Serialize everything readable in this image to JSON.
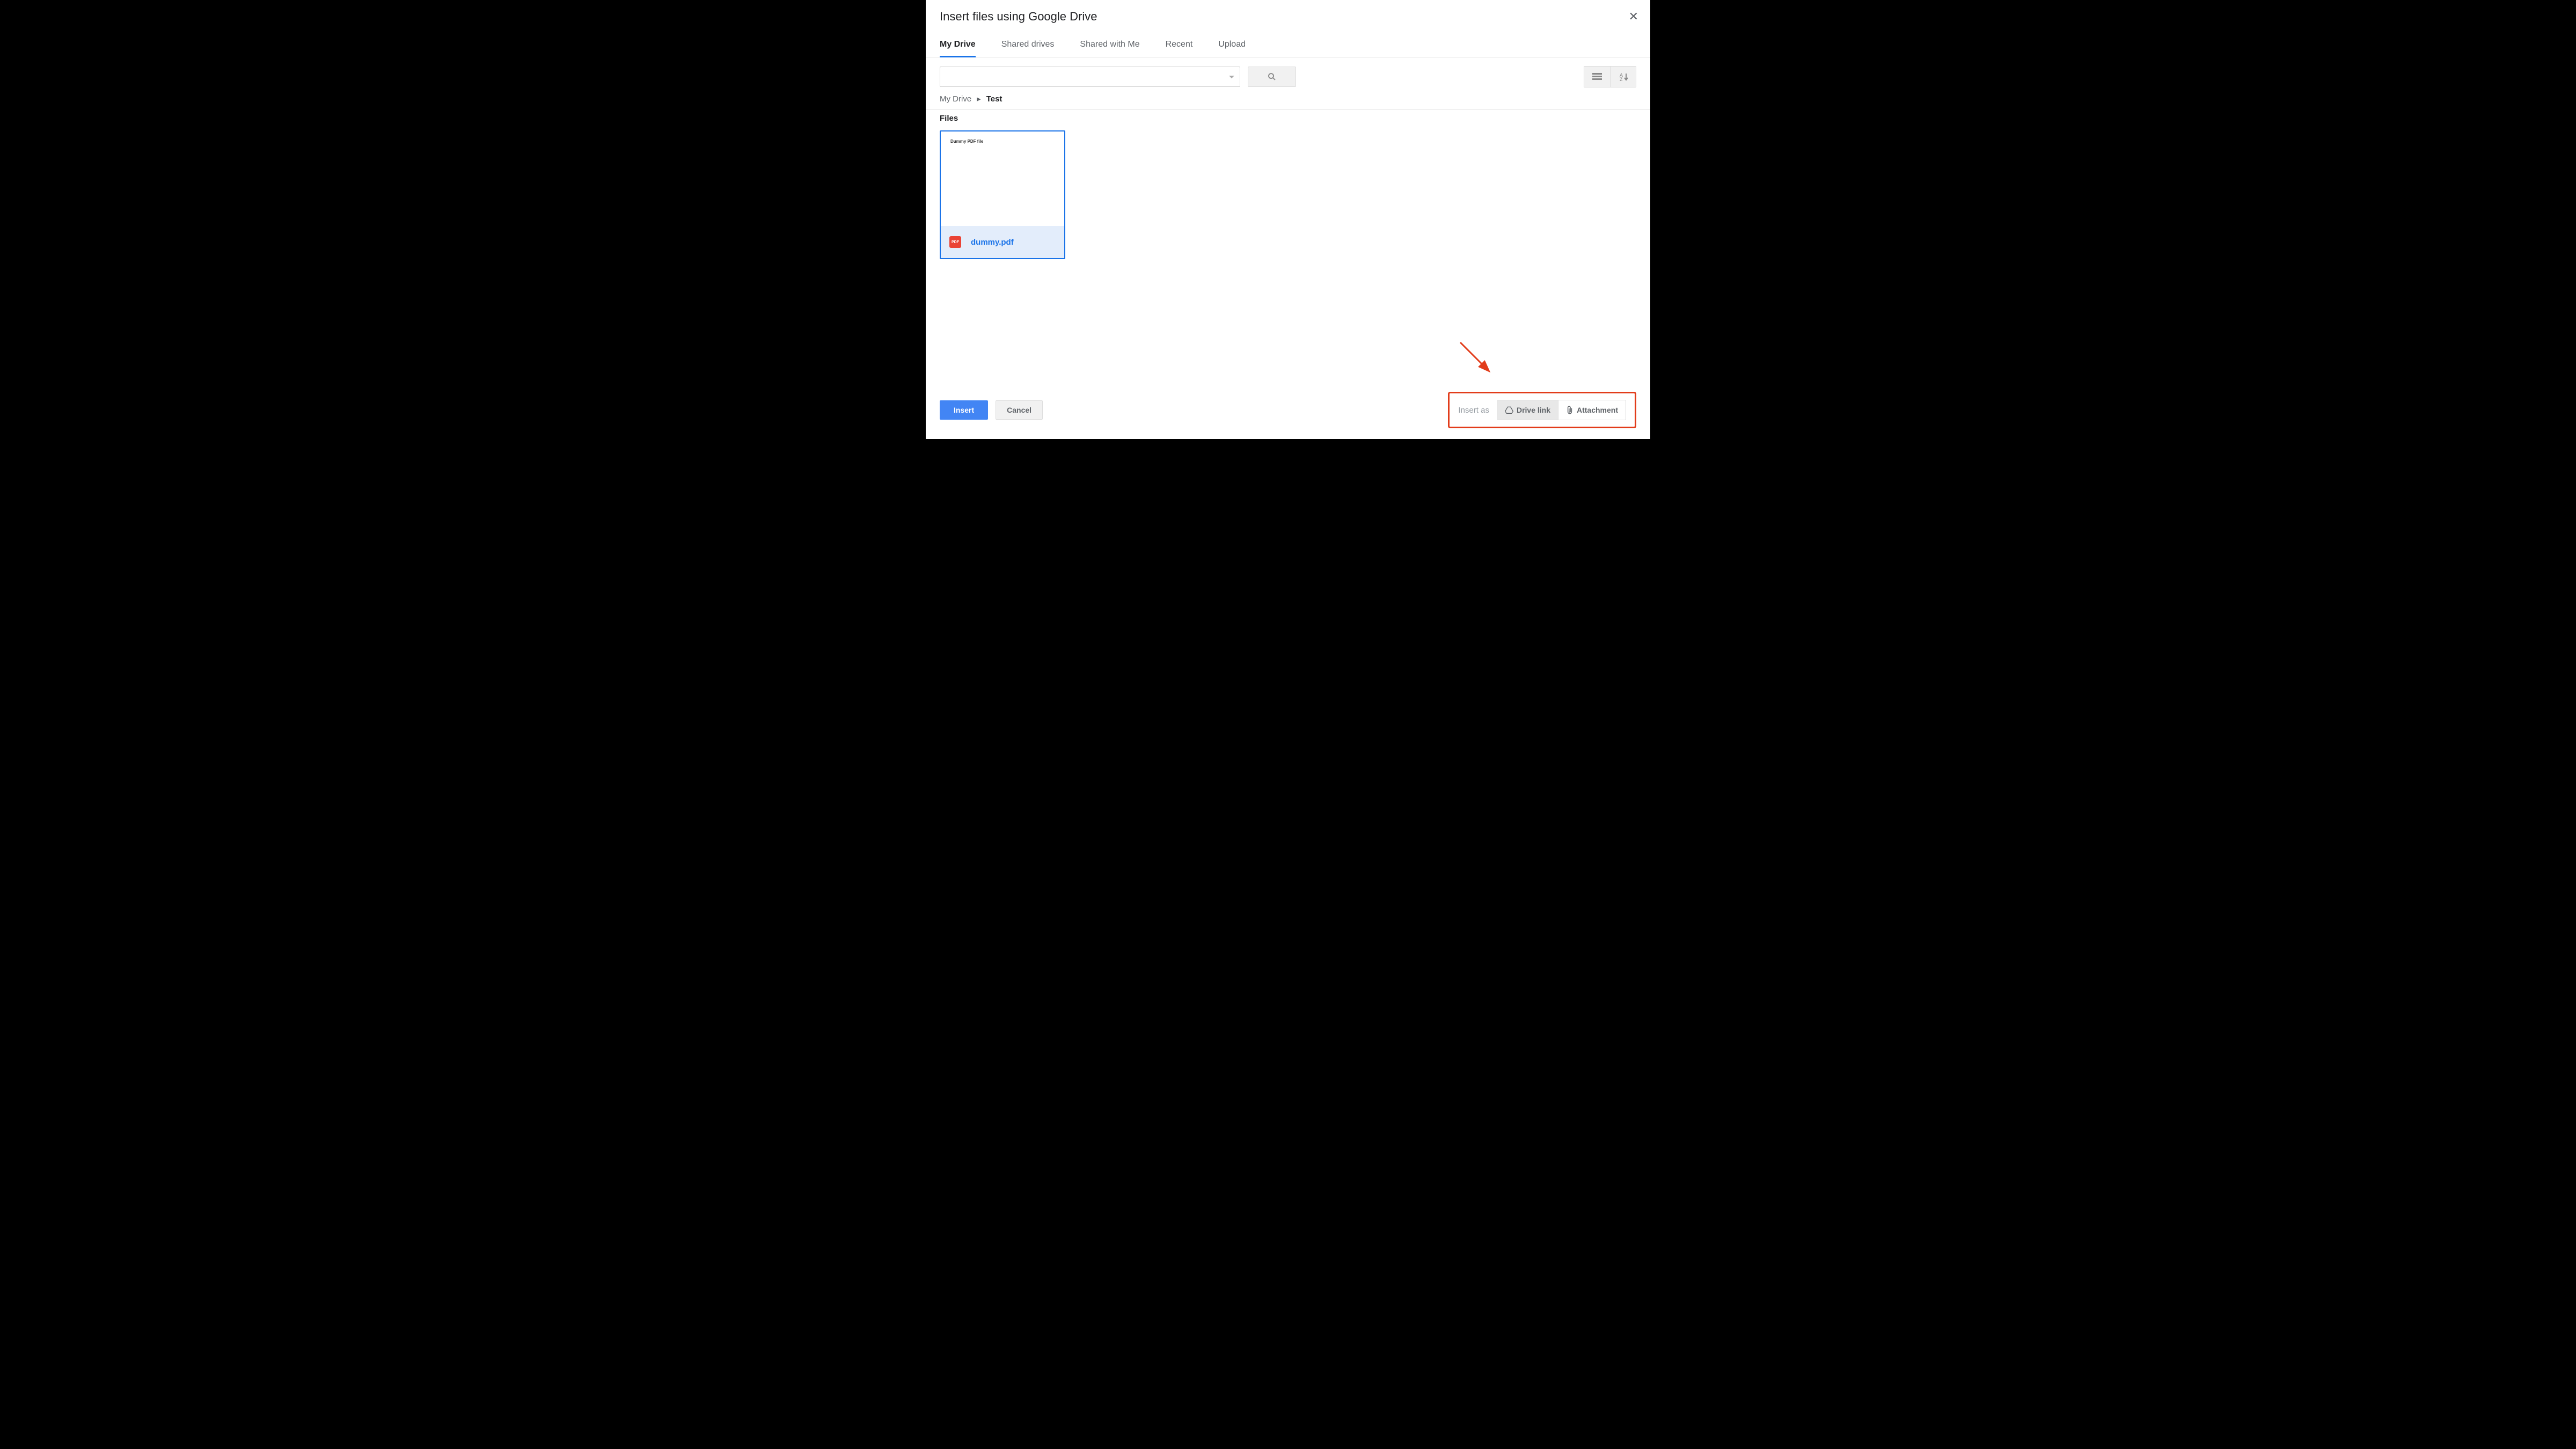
{
  "title": "Insert files using Google Drive",
  "tabs": [
    {
      "label": "My Drive",
      "active": true
    },
    {
      "label": "Shared drives",
      "active": false
    },
    {
      "label": "Shared with Me",
      "active": false
    },
    {
      "label": "Recent",
      "active": false
    },
    {
      "label": "Upload",
      "active": false
    }
  ],
  "search": {
    "value": ""
  },
  "breadcrumb": {
    "root": "My Drive",
    "current": "Test"
  },
  "section": {
    "files_label": "Files"
  },
  "files": [
    {
      "name": "dummy.pdf",
      "preview_text": "Dummy PDF file",
      "type_badge": "PDF",
      "selected": true
    }
  ],
  "footer": {
    "insert_label": "Insert",
    "cancel_label": "Cancel",
    "insert_as_label": "Insert as",
    "drive_link_label": "Drive link",
    "attachment_label": "Attachment",
    "selected_mode": "drive_link"
  }
}
